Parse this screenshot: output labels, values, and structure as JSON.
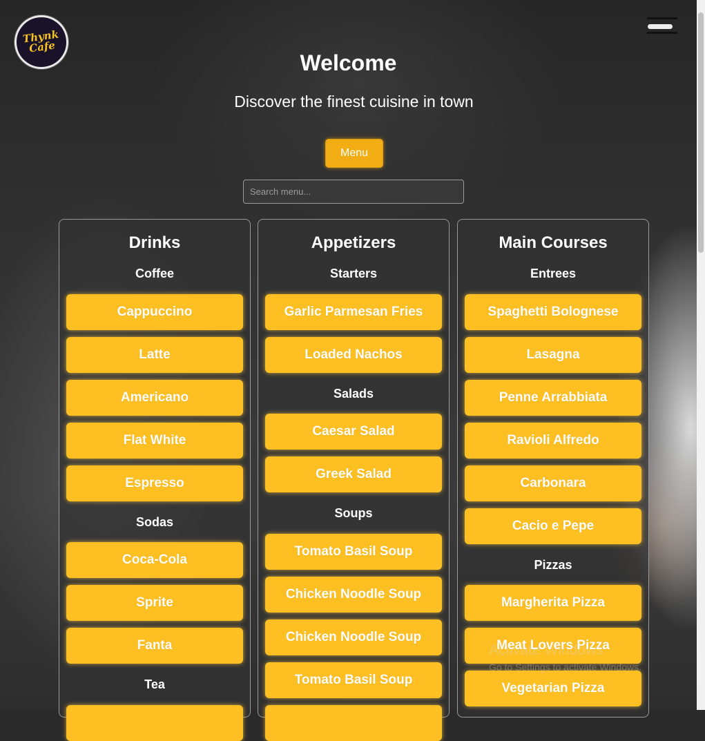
{
  "header": {
    "logo_line1": "Thynk",
    "logo_line2": "Cafe",
    "title": "Welcome",
    "subtitle": "Discover the finest cuisine in town",
    "menu_button": "Menu",
    "search_placeholder": "Search menu..."
  },
  "columns": [
    {
      "heading": "Drinks",
      "sections": [
        {
          "name": "Coffee",
          "items": [
            "Cappuccino",
            "Latte",
            "Americano",
            "Flat White",
            "Espresso"
          ]
        },
        {
          "name": "Sodas",
          "items": [
            "Coca-Cola",
            "Sprite",
            "Fanta"
          ]
        },
        {
          "name": "Tea",
          "items": [
            ""
          ]
        }
      ]
    },
    {
      "heading": "Appetizers",
      "sections": [
        {
          "name": "Starters",
          "items": [
            "Garlic Parmesan Fries",
            "Loaded Nachos"
          ]
        },
        {
          "name": "Salads",
          "items": [
            "Caesar Salad",
            "Greek Salad"
          ]
        },
        {
          "name": "Soups",
          "items": [
            "Tomato Basil Soup",
            "Chicken Noodle Soup",
            "Chicken Noodle Soup",
            "Tomato Basil Soup",
            ""
          ]
        }
      ]
    },
    {
      "heading": "Main Courses",
      "sections": [
        {
          "name": "Entrees",
          "items": [
            "Spaghetti Bolognese",
            "Lasagna",
            "Penne Arrabbiata",
            "Ravioli Alfredo",
            "Carbonara",
            "Cacio e Pepe"
          ]
        },
        {
          "name": "Pizzas",
          "items": [
            "Margherita Pizza",
            "Meat Lovers Pizza",
            "Vegetarian Pizza"
          ]
        }
      ]
    }
  ],
  "watermark": {
    "line1": "Activate Windows",
    "line2": "Go to Settings to activate Windows."
  },
  "colors": {
    "accent": "#fdbf21",
    "menu_button": "#f3ad14"
  },
  "icons": {
    "menu_toggle": "hamburger-icon"
  }
}
